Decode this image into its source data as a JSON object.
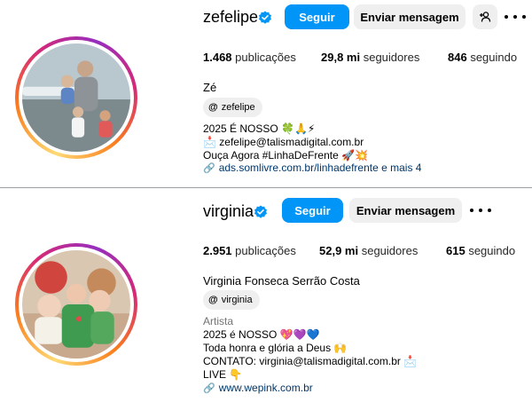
{
  "profiles": [
    {
      "username": "zefelipe",
      "follow_label": "Seguir",
      "message_label": "Enviar mensagem",
      "stats": {
        "posts_value": "1.468",
        "posts_label": "publicações",
        "followers_value": "29,8 mi",
        "followers_label": "seguidores",
        "following_value": "846",
        "following_label": "seguindo"
      },
      "full_name": "Zé",
      "threads_handle": "zefelipe",
      "category": "",
      "bio": [
        "2025 É NOSSO 🍀🙏⚡",
        "📩 zefelipe@talismadigital.com.br",
        "Ouça Agora #LinhaDeFrente 🚀💥"
      ],
      "link_text": "ads.somlivre.com.br/linhadefrente e mais 4"
    },
    {
      "username": "virginia",
      "follow_label": "Seguir",
      "message_label": "Enviar mensagem",
      "stats": {
        "posts_value": "2.951",
        "posts_label": "publicações",
        "followers_value": "52,9 mi",
        "followers_label": "seguidores",
        "following_value": "615",
        "following_label": "seguindo"
      },
      "full_name": "Virginia Fonseca Serrão Costa",
      "threads_handle": "virginia",
      "category": "Artista",
      "bio": [
        "2025 é NOSSO 💖💜💙",
        "Toda honra e glória a Deus 🙌",
        "CONTATO: virginia@talismadigital.com.br 📩",
        "LIVE 👇"
      ],
      "link_text": "www.wepink.com.br"
    }
  ],
  "colors": {
    "accent": "#0095f6",
    "verified": "#0095f6",
    "link": "#00376b"
  }
}
